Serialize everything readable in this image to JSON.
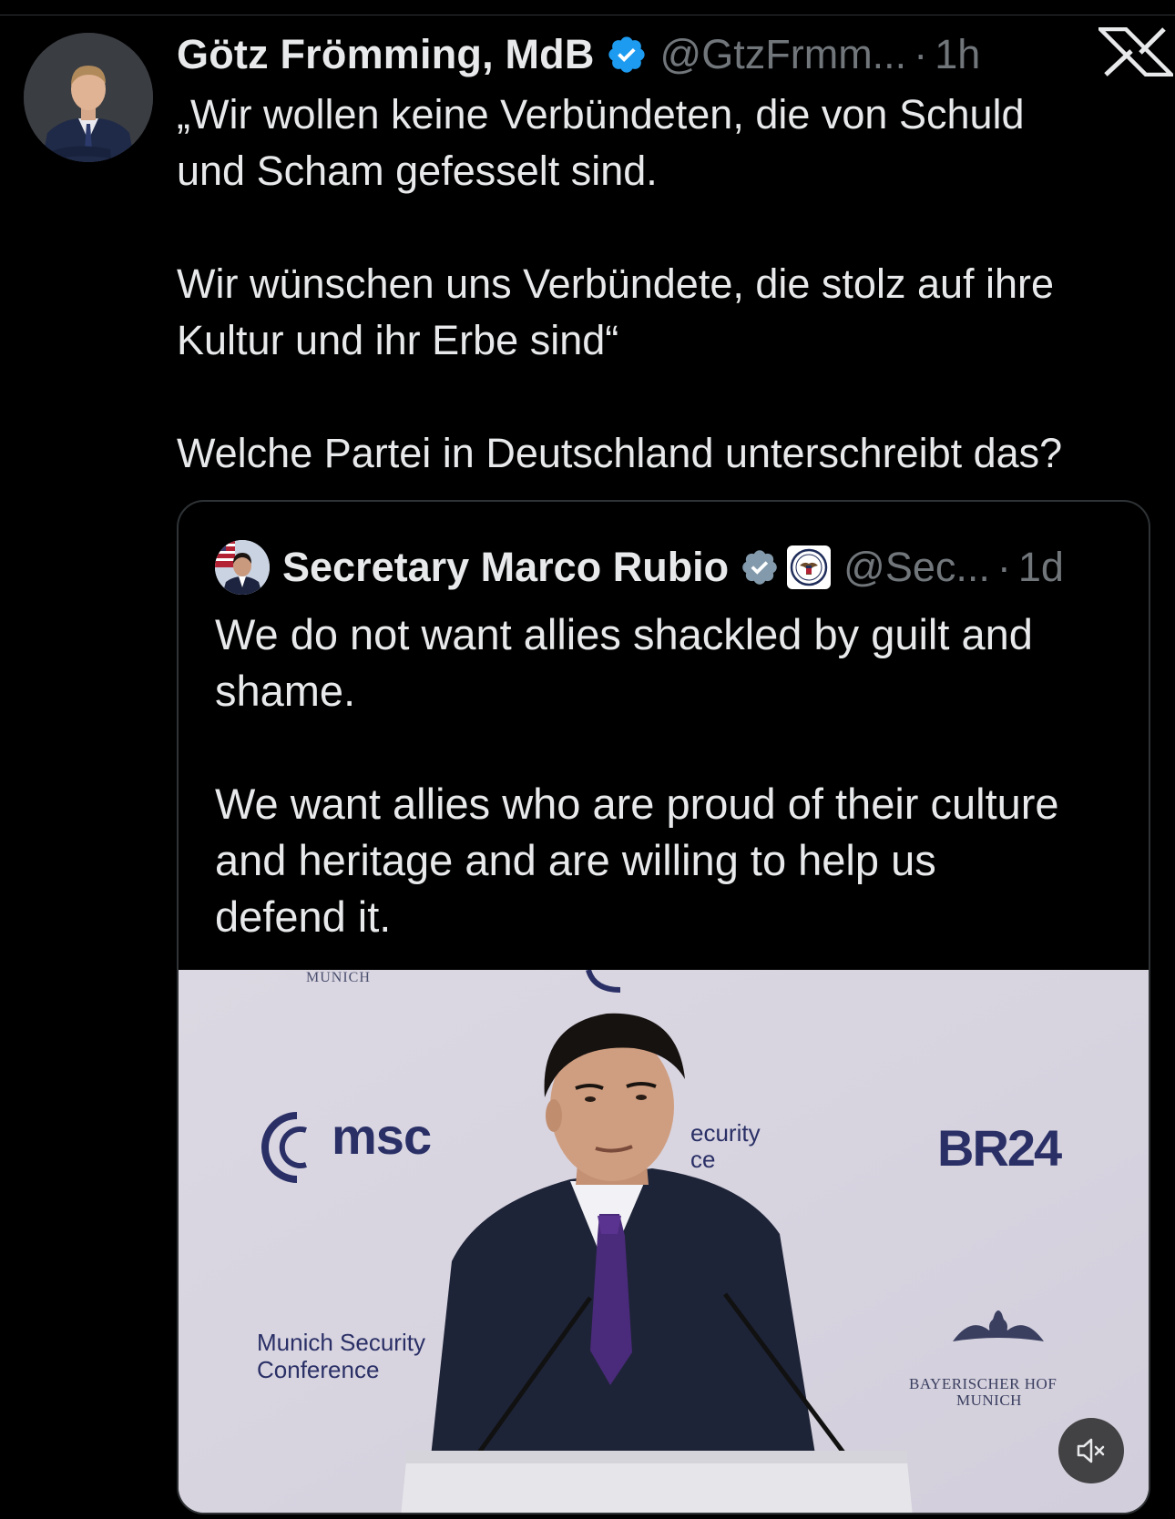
{
  "tweet": {
    "author_name": "Götz Frömming, MdB",
    "handle": "@GtzFrmm...",
    "separator": "·",
    "time": "1h",
    "text_line1": "„Wir wollen keine Verbündeten, die von Schuld",
    "text_line2": "und Scham gefesselt sind.",
    "text_line3": "Wir wünschen uns Verbündete, die stolz auf ihre",
    "text_line4": "Kultur und ihr Erbe sind“",
    "text_line5": "Welche Partei in Deutschland unterschreibt das?"
  },
  "quote": {
    "author_name": "Secretary Marco Rubio",
    "handle": "@Sec...",
    "separator": "·",
    "time": "1d",
    "text_line1": "We do not want allies shackled by guilt and",
    "text_line2": "shame.",
    "text_line3": "We want allies who are proud of their culture",
    "text_line4": "and heritage and are willing to help us",
    "text_line5": "defend it."
  },
  "media": {
    "munich_top": "MUNICH",
    "msc_logo": "msc",
    "security_fragment_1": "ecurity",
    "security_fragment_2": "ce",
    "br24": "BR24",
    "msc_full_1": "Munich Security",
    "msc_full_2": "Conference",
    "bayerischer_hof_1": "BAYERISCHER HOF",
    "bayerischer_hof_2": "MUNICH"
  },
  "icons": {
    "verified": "verified-badge-icon",
    "platform": "x-logo-icon",
    "seal": "state-department-seal-icon",
    "mute": "volume-muted-icon"
  },
  "colors": {
    "background": "#000000",
    "text_primary": "#e7e9ea",
    "text_secondary": "#71767b",
    "verified_blue": "#1d9bf0",
    "verified_gray": "#829aab",
    "border": "#2f3336"
  }
}
